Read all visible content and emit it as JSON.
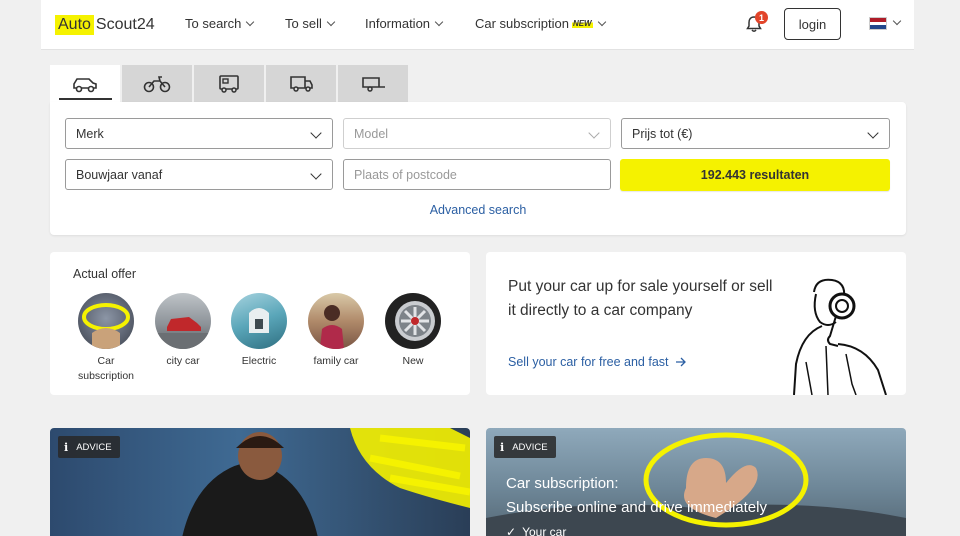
{
  "header": {
    "logo_left": "Auto",
    "logo_right": "Scout24",
    "nav": [
      {
        "label": "To search"
      },
      {
        "label": "To sell"
      },
      {
        "label": "Information"
      },
      {
        "label": "Car subscription",
        "badge": "NEW"
      }
    ],
    "notification_count": "1",
    "login_label": "login",
    "language_flag": "netherlands-flag-icon"
  },
  "search": {
    "tabs": [
      "car-icon",
      "motorcycle-icon",
      "camper-icon",
      "van-icon",
      "trailer-icon"
    ],
    "make": "Merk",
    "model": "Model",
    "price_to": "Prijs tot (€)",
    "year_from": "Bouwjaar vanaf",
    "location_placeholder": "Plaats of postcode",
    "results_label": "192.443 resultaten",
    "advanced_link": "Advanced search"
  },
  "offer": {
    "title": "Actual offer",
    "items": [
      {
        "label": "Car subscription"
      },
      {
        "label": "city car"
      },
      {
        "label": "Electric"
      },
      {
        "label": "family car"
      },
      {
        "label": "New"
      }
    ]
  },
  "sell": {
    "title": "Put your car up for sale yourself or sell it directly to a car company",
    "link": "Sell your car for free and fast"
  },
  "advice_cards": [
    {
      "badge": "ADVICE"
    },
    {
      "badge": "ADVICE",
      "title": "Car subscription:",
      "subtitle": "Subscribe online and drive immediately",
      "bullet": "Your car"
    }
  ],
  "colors": {
    "brand_yellow": "#f5f200",
    "link_blue": "#2b5fa3",
    "badge_red": "#e2452a"
  }
}
